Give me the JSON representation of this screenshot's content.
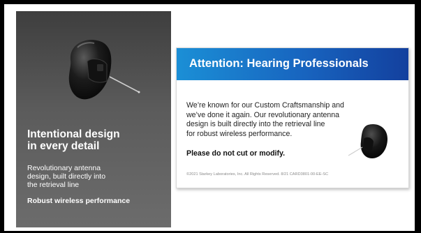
{
  "left_panel": {
    "headline_lines": [
      "Intentional design",
      "in every detail"
    ],
    "subtext_lines": [
      "Revolutionary antenna",
      "design, built directly into",
      "the retrieval line"
    ],
    "emphasis": "Robust wireless performance"
  },
  "card": {
    "title": "Attention: Hearing Professionals",
    "body_lines": [
      "We’re known for our Custom Craftsmanship and",
      "we’ve done it again. Our revolutionary antenna",
      "design is built directly into the retrieval line",
      "for robust wireless performance."
    ],
    "warning": "Please do not cut or modify.",
    "footer": "©2021 Starkey Laboratories, Inc. All Rights Reserved. 8/21 CARD3801-00-EE-SC"
  },
  "colors": {
    "panel_dark": "#3e3e3e",
    "panel_light": "#6c6c6c",
    "header_blue_start": "#1b8fd6",
    "header_blue_end": "#13409e"
  }
}
